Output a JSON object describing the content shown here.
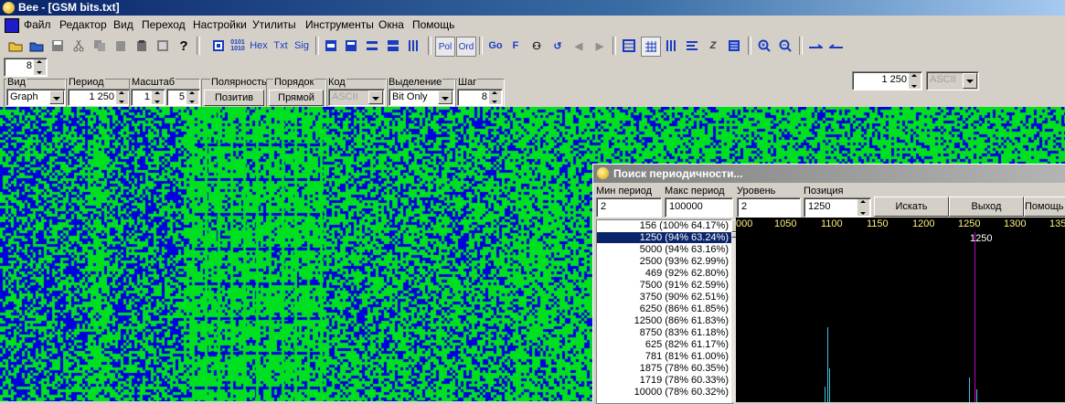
{
  "window": {
    "title": "Bee - [GSM bits.txt]"
  },
  "menu": [
    "Файл",
    "Редактор",
    "Вид",
    "Переход",
    "Настройки",
    "Утилиты",
    "Инструменты",
    "Окна",
    "Помощь"
  ],
  "toolbar": {
    "text_buttons": [
      "0101\n1010",
      "Hex",
      "Txt",
      "Sig",
      "Pol",
      "Ord",
      "Go",
      "F"
    ],
    "period_value": "1 250",
    "encoding_value": "ASCII",
    "width_value": "8"
  },
  "controls": {
    "view": {
      "label": "Вид",
      "value": "Graph"
    },
    "period": {
      "label": "Период",
      "value": "1 250"
    },
    "scale": {
      "label": "Масштаб",
      "value1": "1",
      "value2": "5"
    },
    "polarity": {
      "label": "Полярность",
      "button": "Позитив"
    },
    "order": {
      "label": "Порядок",
      "button": "Прямой"
    },
    "code": {
      "label": "Код",
      "value": "ASCII"
    },
    "selection": {
      "label": "Выделение",
      "value": "Bit Only"
    },
    "step": {
      "label": "Шаг",
      "value": "8"
    }
  },
  "dialog": {
    "title": "Поиск периодичности...",
    "min_period": {
      "label": "Мин период",
      "value": "2"
    },
    "max_period": {
      "label": "Макс период",
      "value": "100000"
    },
    "level": {
      "label": "Уровень",
      "value": "2"
    },
    "position": {
      "label": "Позиция",
      "value": "1250"
    },
    "buttons": {
      "search": "Искать",
      "exit": "Выход",
      "help": "Помощь"
    },
    "results": [
      "156 (100% 64.17%)",
      "1250 (94% 63.24%)",
      "5000 (94% 63.16%)",
      "2500 (93% 62.99%)",
      "469 (92% 62.80%)",
      "7500 (91% 62.59%)",
      "3750 (90% 62.51%)",
      "6250 (86% 61.85%)",
      "12500 (86% 61.83%)",
      "8750 (83% 61.18%)",
      "625 (82% 61.17%)",
      "781 (81% 61.00%)",
      "1875 (78% 60.35%)",
      "1719 (78% 60.33%)",
      "10000 (78% 60.32%)"
    ],
    "selected_index": 1,
    "plot": {
      "x_ticks": [
        "000",
        "1050",
        "1100",
        "1150",
        "1200",
        "1250",
        "1300",
        "135"
      ],
      "marker_label": "1250",
      "colors": {
        "background": "#000000",
        "marker": "#c000c0",
        "ticks": "#ffef80",
        "peaks": "#40c0e0"
      }
    }
  },
  "colors": {
    "bit_one": "#00e020",
    "bit_zero": "#0000e0"
  }
}
